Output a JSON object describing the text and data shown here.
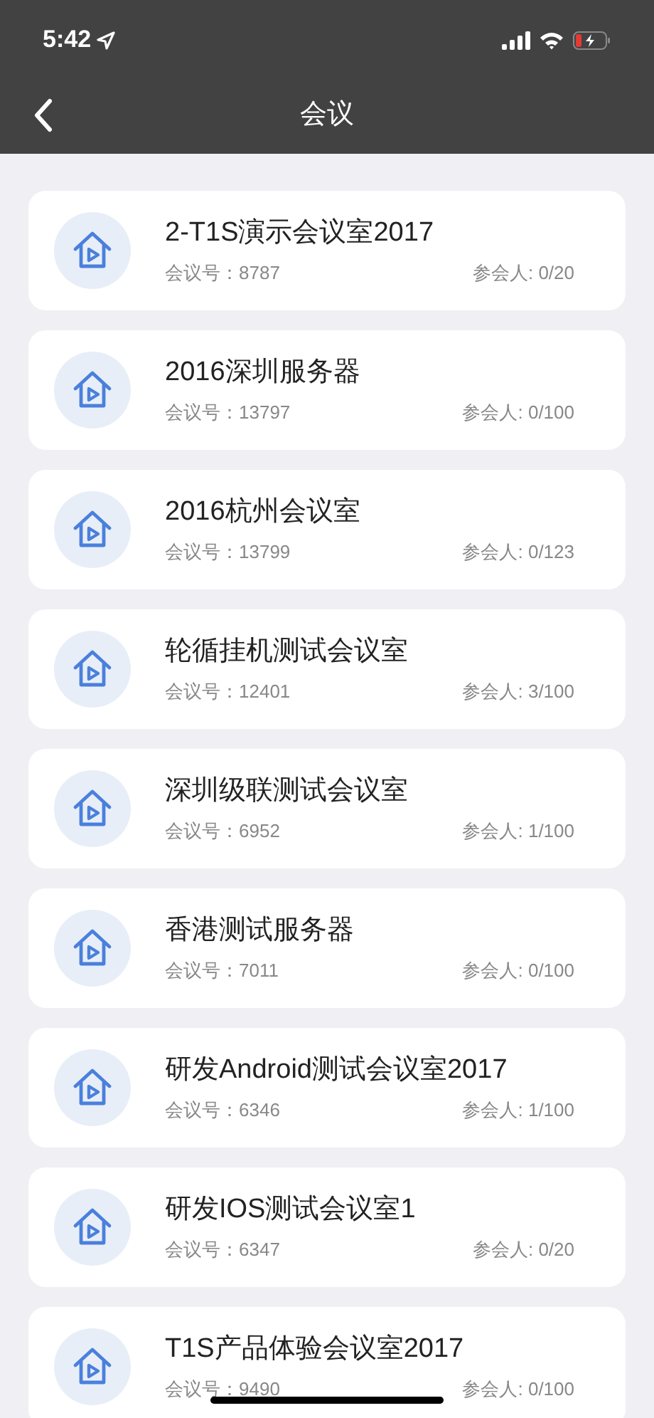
{
  "status_bar": {
    "time": "5:42"
  },
  "nav": {
    "title": "会议"
  },
  "meetings": [
    {
      "name": "2-T1S演示会议室2017",
      "number": "会议号：8787",
      "participants": "参会人: 0/20"
    },
    {
      "name": "2016深圳服务器",
      "number": "会议号：13797",
      "participants": "参会人: 0/100"
    },
    {
      "name": "2016杭州会议室",
      "number": "会议号：13799",
      "participants": "参会人: 0/123"
    },
    {
      "name": "轮循挂机测试会议室",
      "number": "会议号：12401",
      "participants": "参会人: 3/100"
    },
    {
      "name": "深圳级联测试会议室",
      "number": "会议号：6952",
      "participants": "参会人: 1/100"
    },
    {
      "name": "香港测试服务器",
      "number": "会议号：7011",
      "participants": "参会人: 0/100"
    },
    {
      "name": "研发Android测试会议室2017",
      "number": "会议号：6346",
      "participants": "参会人: 1/100"
    },
    {
      "name": "研发IOS测试会议室1",
      "number": "会议号：6347",
      "participants": "参会人: 0/20"
    },
    {
      "name": "T1S产品体验会议室2017",
      "number": "会议号：9490",
      "participants": "参会人: 0/100"
    }
  ]
}
